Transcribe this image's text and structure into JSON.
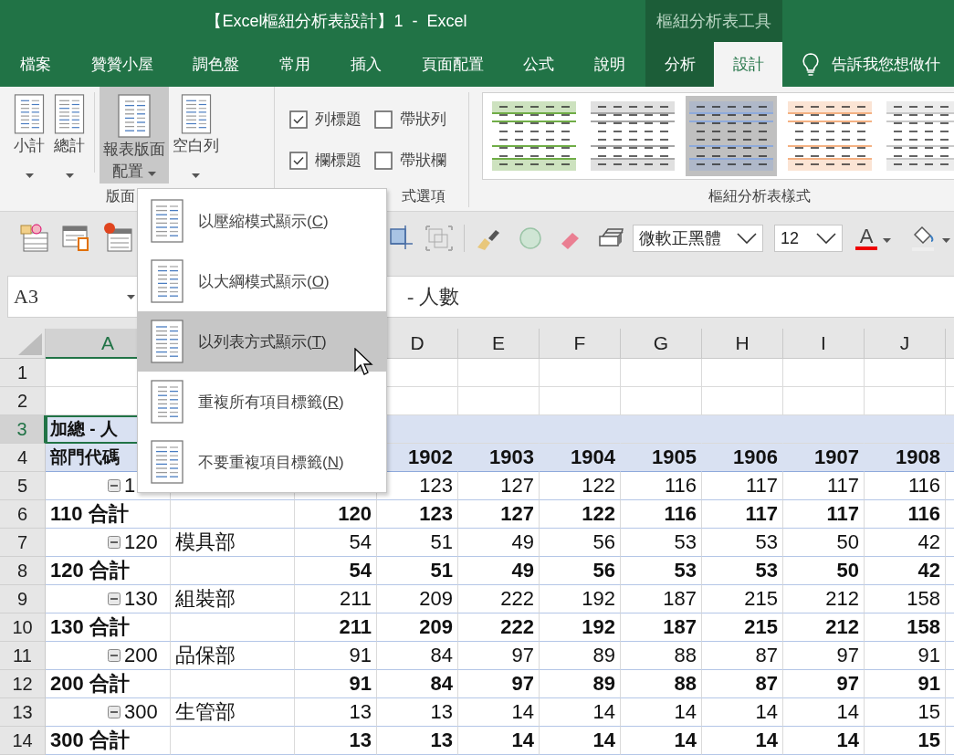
{
  "window": {
    "title": "【Excel樞紐分析表設計】1  -  Excel",
    "context_header": "樞紐分析表工具"
  },
  "tabs": [
    {
      "label": "檔案",
      "kind": "standard",
      "selected": false
    },
    {
      "label": "贊贊小屋",
      "kind": "standard",
      "selected": false
    },
    {
      "label": "調色盤",
      "kind": "standard",
      "selected": false
    },
    {
      "label": "常用",
      "kind": "standard",
      "selected": false
    },
    {
      "label": "插入",
      "kind": "standard",
      "selected": false
    },
    {
      "label": "頁面配置",
      "kind": "standard",
      "selected": false
    },
    {
      "label": "公式",
      "kind": "standard",
      "selected": false
    },
    {
      "label": "說明",
      "kind": "standard",
      "selected": false
    },
    {
      "label": "分析",
      "kind": "contextual",
      "selected": false
    },
    {
      "label": "設計",
      "kind": "contextual",
      "selected": true
    }
  ],
  "tell_me": "告訴我您想做什",
  "ribbon": {
    "layout_group": {
      "label": "版面",
      "buttons": [
        {
          "lines": [
            "小計"
          ],
          "pressed": false
        },
        {
          "lines": [
            "總計"
          ],
          "pressed": false
        },
        {
          "lines": [
            "報表版面",
            "配置"
          ],
          "pressed": true
        },
        {
          "lines": [
            "空白列"
          ],
          "pressed": false
        }
      ]
    },
    "options_group": {
      "label": "式選項",
      "checkboxes": [
        {
          "label": "列標題",
          "checked": true
        },
        {
          "label": "帶狀列",
          "checked": false
        },
        {
          "label": "欄標題",
          "checked": true
        },
        {
          "label": "帶狀欄",
          "checked": false
        }
      ]
    },
    "styles_group": {
      "label": "樞紐分析表樣式",
      "gallery": [
        {
          "color": "#70ad47",
          "selected": false
        },
        {
          "color": "#a5a5a5",
          "selected": false
        },
        {
          "color": "#8eaadb",
          "selected": true
        },
        {
          "color": "#f4b183",
          "selected": false
        },
        {
          "color": "#c9c9c9",
          "selected": false
        }
      ]
    }
  },
  "toolbar": {
    "font": "微軟正黑體",
    "size": "12",
    "font_color_label": "A"
  },
  "formula_bar": {
    "name_box": "A3",
    "formula": "- 人數"
  },
  "menu": {
    "items": [
      {
        "label": "以壓縮模式顯示",
        "mnemonic": "(C)",
        "selected": false
      },
      {
        "label": "以大綱模式顯示",
        "mnemonic": "(O)",
        "selected": false
      },
      {
        "label": "以列表方式顯示",
        "mnemonic": "(T)",
        "selected": true
      },
      {
        "label": "重複所有項目標籤",
        "mnemonic": "(R)",
        "selected": false
      },
      {
        "label": "不要重複項目標籤",
        "mnemonic": "(N)",
        "selected": false
      }
    ]
  },
  "column_headers": [
    {
      "label": "A",
      "active": true
    },
    {
      "label": "D",
      "active": false
    },
    {
      "label": "E",
      "active": false
    },
    {
      "label": "F",
      "active": false
    },
    {
      "label": "G",
      "active": false
    },
    {
      "label": "H",
      "active": false
    },
    {
      "label": "I",
      "active": false
    },
    {
      "label": "J",
      "active": false
    }
  ],
  "rows": [
    {
      "number": "1",
      "kind": "blank",
      "active": false
    },
    {
      "number": "2",
      "kind": "blank",
      "active": false
    },
    {
      "number": "3",
      "kind": "title",
      "active": true,
      "cells": [
        "加總 - 人"
      ]
    },
    {
      "number": "4",
      "kind": "header",
      "active": false,
      "cells": [
        "部門代碼",
        null,
        null,
        "1902",
        "1903",
        "1904",
        "1905",
        "1906",
        "1907",
        "1908"
      ]
    },
    {
      "number": "5",
      "kind": "item",
      "active": false,
      "expanded": true,
      "cells": [
        "1",
        null,
        null,
        "123",
        "127",
        "122",
        "116",
        "117",
        "117",
        "116"
      ]
    },
    {
      "number": "6",
      "kind": "total",
      "active": false,
      "cells": [
        "110 合計",
        null,
        "120",
        "123",
        "127",
        "122",
        "116",
        "117",
        "117",
        "116"
      ]
    },
    {
      "number": "7",
      "kind": "item",
      "active": false,
      "expanded": true,
      "cells": [
        "120",
        "模具部",
        "54",
        "51",
        "49",
        "56",
        "53",
        "53",
        "50",
        "42"
      ]
    },
    {
      "number": "8",
      "kind": "total",
      "active": false,
      "cells": [
        "120 合計",
        null,
        "54",
        "51",
        "49",
        "56",
        "53",
        "53",
        "50",
        "42"
      ]
    },
    {
      "number": "9",
      "kind": "item",
      "active": false,
      "expanded": true,
      "cells": [
        "130",
        "組裝部",
        "211",
        "209",
        "222",
        "192",
        "187",
        "215",
        "212",
        "158"
      ]
    },
    {
      "number": "10",
      "kind": "total",
      "active": false,
      "cells": [
        "130 合計",
        null,
        "211",
        "209",
        "222",
        "192",
        "187",
        "215",
        "212",
        "158"
      ]
    },
    {
      "number": "11",
      "kind": "item",
      "active": false,
      "expanded": true,
      "cells": [
        "200",
        "品保部",
        "91",
        "84",
        "97",
        "89",
        "88",
        "87",
        "97",
        "91"
      ]
    },
    {
      "number": "12",
      "kind": "total",
      "active": false,
      "cells": [
        "200 合計",
        null,
        "91",
        "84",
        "97",
        "89",
        "88",
        "87",
        "97",
        "91"
      ]
    },
    {
      "number": "13",
      "kind": "item",
      "active": false,
      "expanded": true,
      "cells": [
        "300",
        "生管部",
        "13",
        "13",
        "14",
        "14",
        "14",
        "14",
        "14",
        "15"
      ]
    },
    {
      "number": "14",
      "kind": "total",
      "active": false,
      "cells": [
        "300 合計",
        null,
        "13",
        "13",
        "14",
        "14",
        "14",
        "14",
        "14",
        "15"
      ]
    }
  ]
}
